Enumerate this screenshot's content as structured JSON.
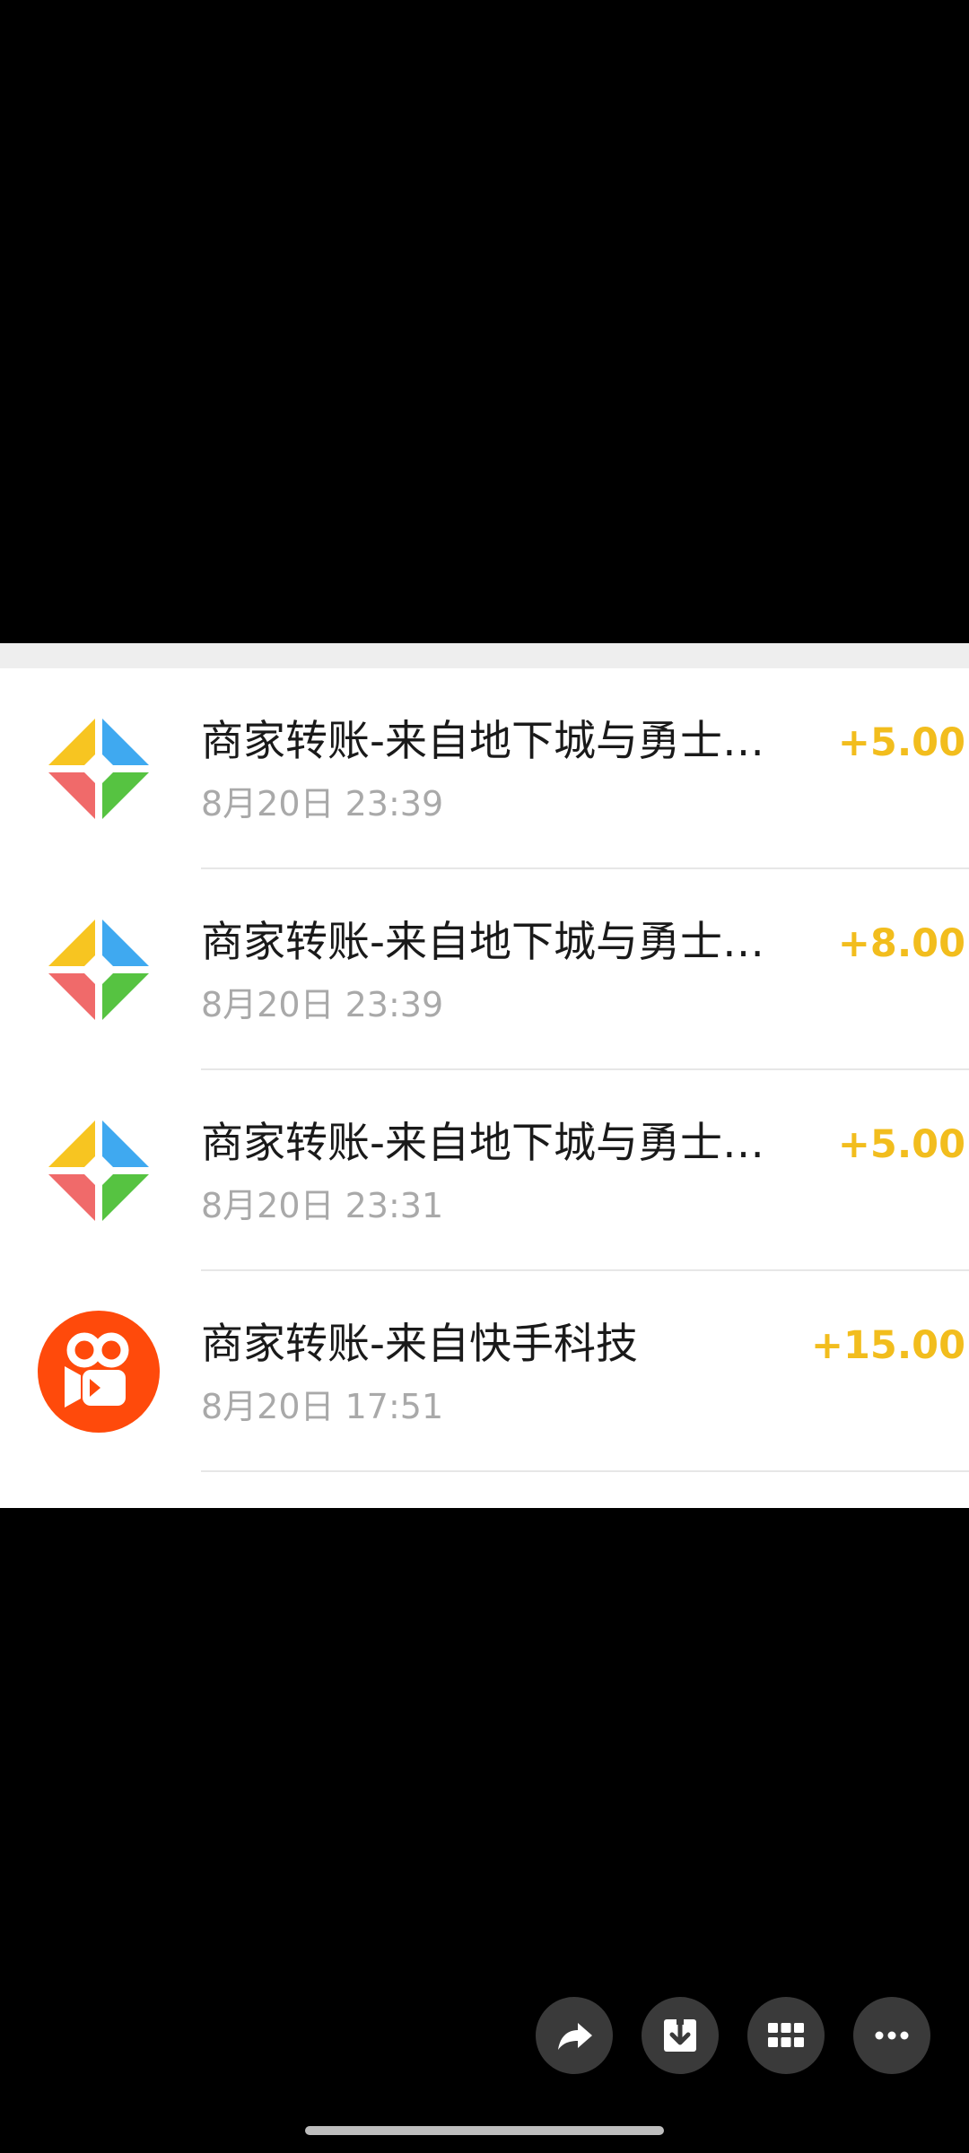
{
  "transactions": [
    {
      "title": "商家转账-来自地下城与勇士…",
      "time": "8月20日 23:39",
      "amount": "+5.00",
      "icon": "dnf-game-logo-icon"
    },
    {
      "title": "商家转账-来自地下城与勇士…",
      "time": "8月20日 23:39",
      "amount": "+8.00",
      "icon": "dnf-game-logo-icon"
    },
    {
      "title": "商家转账-来自地下城与勇士…",
      "time": "8月20日 23:31",
      "amount": "+5.00",
      "icon": "dnf-game-logo-icon"
    },
    {
      "title": "商家转账-来自快手科技",
      "time": "8月20日 17:51",
      "amount": "+15.00",
      "icon": "kuaishou-logo-icon"
    }
  ],
  "toolbar": {
    "share": "share-icon",
    "download": "download-icon",
    "grid": "grid-icon",
    "more": "more-icon"
  },
  "colors": {
    "amount": "#f2bd1d",
    "kuaishou": "#ff4a0b",
    "background": "#000000"
  }
}
